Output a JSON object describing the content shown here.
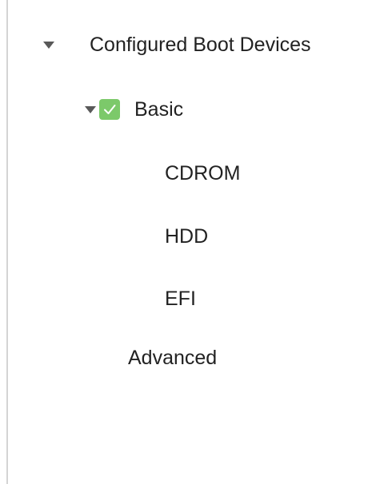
{
  "tree": {
    "root": {
      "label": "Configured Boot Devices",
      "expanded": true,
      "caret_icon": "caret-down-icon"
    },
    "basic": {
      "label": "Basic",
      "expanded": true,
      "checked": true,
      "caret_icon": "caret-down-icon",
      "checkbox_icon": "checkmark-icon",
      "children": [
        {
          "label": "CDROM"
        },
        {
          "label": "HDD"
        },
        {
          "label": "EFI"
        }
      ]
    },
    "advanced": {
      "label": "Advanced"
    }
  },
  "colors": {
    "checkbox_fill": "#7cc96a",
    "caret": "#595959",
    "border": "#d4d4d4",
    "text": "#222222"
  }
}
